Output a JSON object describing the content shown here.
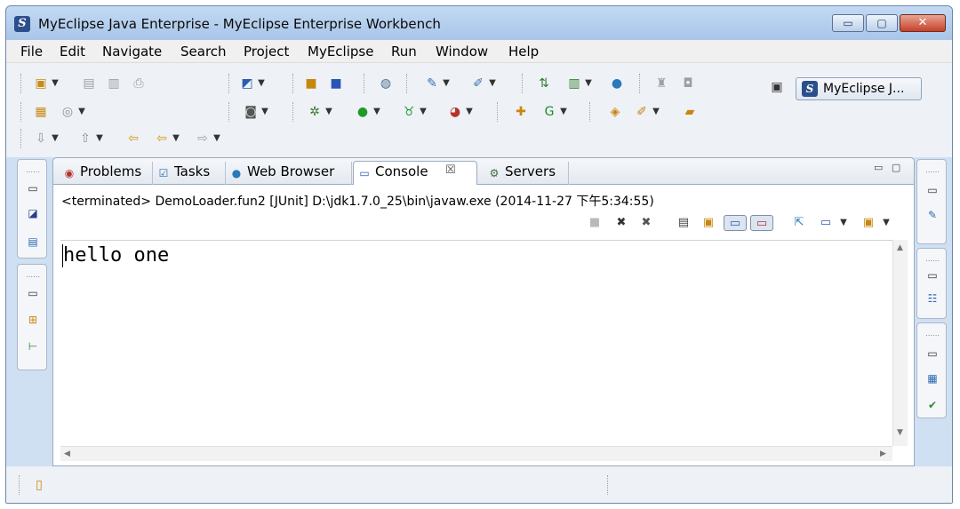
{
  "window": {
    "title": "MyEclipse Java Enterprise - MyEclipse Enterprise Workbench",
    "app_icon": "myeclipse-logo-icon",
    "minimize_glyph": "▭",
    "maximize_glyph": "▢",
    "close_glyph": "✕"
  },
  "menu": [
    "File",
    "Edit",
    "Navigate",
    "Search",
    "Project",
    "MyEclipse",
    "Run",
    "Window",
    "Help"
  ],
  "toolbar": {
    "dropdown_glyph": "▼",
    "icons_row1": [
      "new-wizard-icon",
      "save-icon",
      "save-all-icon",
      "print-icon",
      "new-web-project-icon",
      "new-package-icon",
      "new-class-icon",
      "deploy-icon",
      "new-servlet-icon",
      "new-jsp-icon",
      "server-deploy-icon",
      "run-server-icon",
      "web-browser-icon",
      "ear-icon",
      "bean-icon"
    ],
    "icons_row2": [
      "properties-icon",
      "globe-settings-icon",
      "camera-icon",
      "debug-icon",
      "run-icon",
      "coverage-icon",
      "external-tools-icon",
      "new-java-project-icon",
      "new-type-icon",
      "open-project-icon",
      "search-icon",
      "open-folder-icon"
    ],
    "icons_row3": [
      "next-annotation-icon",
      "previous-annotation-icon",
      "last-edit-location-icon",
      "back-icon",
      "forward-icon"
    ]
  },
  "perspective": {
    "open_perspective_icon": "open-perspective-icon",
    "label": "MyEclipse J..."
  },
  "tabs": [
    {
      "label": "Problems",
      "icon": "problems-icon"
    },
    {
      "label": "Tasks",
      "icon": "tasks-icon"
    },
    {
      "label": "Web Browser",
      "icon": "web-browser-icon"
    },
    {
      "label": "Console",
      "icon": "console-icon",
      "close": "☒"
    },
    {
      "label": "Servers",
      "icon": "servers-icon"
    }
  ],
  "console": {
    "status": "<terminated> DemoLoader.fun2 [JUnit] D:\\jdk1.7.0_25\\bin\\javaw.exe (2014-11-27 下午5:34:55)",
    "output": "hello one",
    "toolbar_icons": [
      "terminate-icon",
      "remove-launch-icon",
      "remove-all-terminated-icon",
      "clear-console-icon",
      "scroll-lock-icon",
      "show-console-on-stdout-icon",
      "show-console-on-stderr-icon",
      "pin-console-icon",
      "display-selected-console-icon",
      "open-console-icon"
    ]
  },
  "panel_controls": {
    "minimize": "▭",
    "maximize": "▢"
  },
  "scroll_arrows": {
    "up": "▲",
    "down": "▼",
    "left": "◀",
    "right": "▶"
  }
}
